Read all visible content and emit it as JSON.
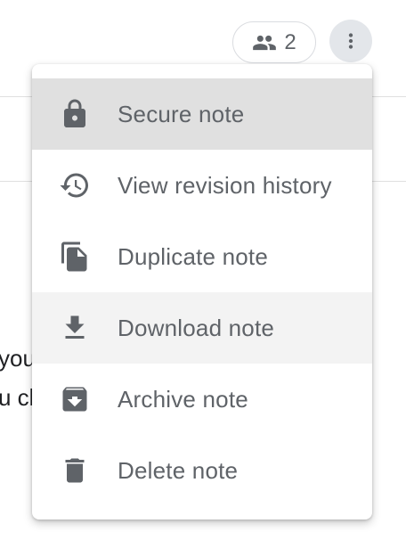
{
  "header": {
    "collaborator_count": "2",
    "collaborators_icon": "people-icon",
    "more_icon": "more-vert-icon"
  },
  "background_text": {
    "line1": "you",
    "line2": "u cl"
  },
  "menu": {
    "items": [
      {
        "label": "Secure note",
        "icon": "lock-icon"
      },
      {
        "label": "View revision history",
        "icon": "history-icon"
      },
      {
        "label": "Duplicate note",
        "icon": "file-copy-icon"
      },
      {
        "label": "Download note",
        "icon": "download-icon"
      },
      {
        "label": "Archive note",
        "icon": "archive-icon"
      },
      {
        "label": "Delete note",
        "icon": "delete-icon"
      }
    ]
  },
  "colors": {
    "icon": "#5f6368",
    "label": "#5f6368",
    "selected_bg": "#e0e0e0",
    "hover_bg": "#f3f3f3"
  }
}
